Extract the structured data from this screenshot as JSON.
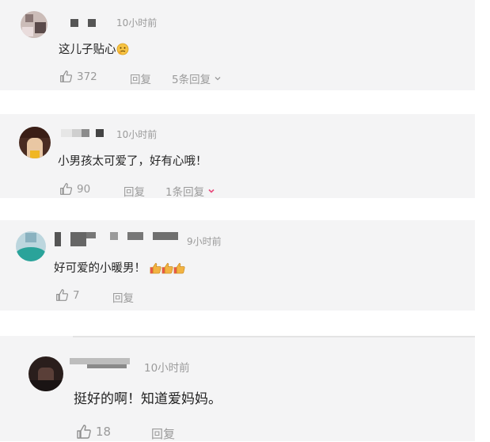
{
  "comments": [
    {
      "time": "10小时前",
      "text": "这儿子贴心",
      "emoji": "thinking-face-icon",
      "likes": "372",
      "reply_label": "回复",
      "replies_label": "5条回复"
    },
    {
      "time": "10小时前",
      "text": "小男孩太可爱了，好有心哦！",
      "likes": "90",
      "reply_label": "回复",
      "replies_label": "1条回复"
    },
    {
      "time": "9小时前",
      "text": "好可爱的小暖男！",
      "emoji": "thumbs-up-icon",
      "emoji_count": 3,
      "likes": "7",
      "reply_label": "回复"
    },
    {
      "time": "10小时前",
      "text": "挺好的啊！知道爱妈妈。",
      "likes": "18",
      "reply_label": "回复"
    }
  ],
  "colors": {
    "card_bg": "#f4f4f5",
    "meta_text": "#9a9a9a",
    "chevron_accent": "#e8497a"
  }
}
